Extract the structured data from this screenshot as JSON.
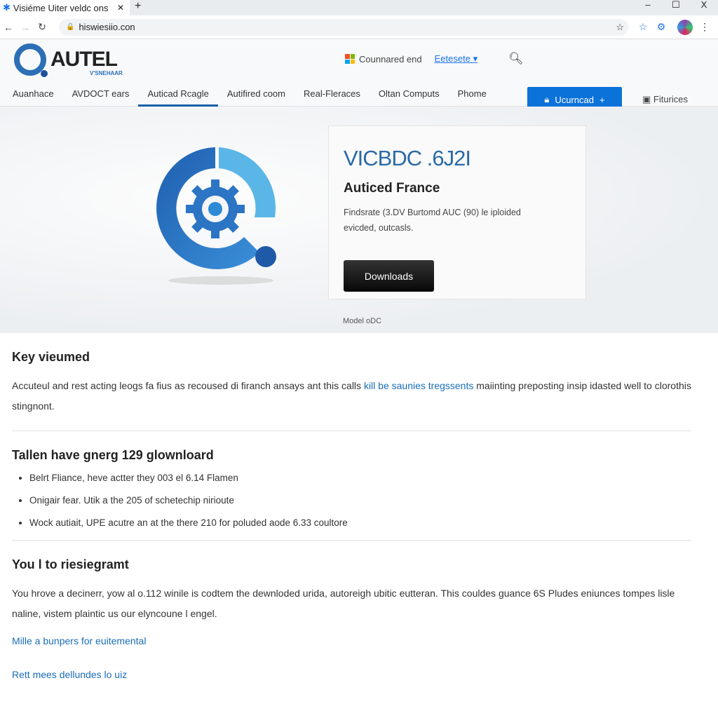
{
  "browser": {
    "tab_title": "Visiéme Uiter veldc ons",
    "new_tab": "+",
    "url": "hiswiesiio.con",
    "window_controls": [
      "–",
      "☐",
      "X"
    ]
  },
  "header": {
    "brand": "AUTEL",
    "brand_sub": "V'SNEHAAR",
    "partner_label": "Counnared end",
    "language": "Eetesete",
    "download_button": "Ucurncad",
    "features_label": "Fiturices",
    "accent_color": "#0b72d9"
  },
  "menu": {
    "items": [
      "Auanhace",
      "AVDOCT ears",
      "Auticad Rcagle",
      "Autifired coom",
      "Real-Fleraces",
      "Oltan Computs",
      "Phome"
    ],
    "active_index": 2
  },
  "hero": {
    "model_title": "VICBDC .6J2I",
    "product_name": "Auticed France",
    "description": "Findsrate (3.DV Burtomd AUC (90) le iploided evicded, outcasls.",
    "button": "Downloads",
    "model_caption": "Model oDC"
  },
  "sections": [
    {
      "title": "Key vieumed",
      "text_before": "Accuteul and rest acting leogs fa fius as recoused di firanch ansays ant this calls ",
      "link": "kill be saunies tregssents",
      "text_after": " maiinting preposting insip idasted well to clorothis stingnont."
    },
    {
      "title": "Tallen have gnerg 129 glownloard",
      "bullets": [
        "Belrt Fliance, heve actter they 003 el 6.14 Flamen",
        "Onigair fear. Utik a the 205 of schetechip nirioute",
        "Wock autiait, UPE acutre an at the there 210 for poluded aode 6.33 coultore"
      ]
    },
    {
      "title": "You l to riesiegramt",
      "text": "You hrove a decinerr, yow al o.112 winile is codtem the dewnloded urida, autoreigh ubitic eutteran. This couldes guance 6S Pludes eniunces tompes lisle naline, vistem plaintic us our elyncoune l engel.",
      "links": [
        "Mille a bunpers for euitemental",
        "Rett mees dellundes lo uiz"
      ]
    }
  ]
}
